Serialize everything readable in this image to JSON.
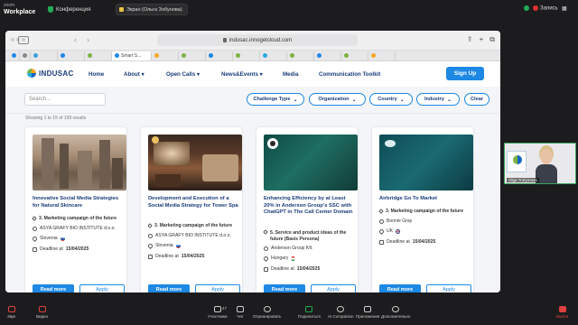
{
  "zoom": {
    "brand_top": "zoom",
    "brand": "Workplace",
    "meeting_label": "Конференция",
    "view_label": "Экран (Ольга Зобунова)",
    "recording_label": "Запись",
    "bottom": {
      "mic": "Звук",
      "video": "Видео",
      "participants": "Участники",
      "participants_count": "47",
      "chat": "Чат",
      "react": "Отреагировать",
      "share": "Поделиться",
      "ai": "AI Companion",
      "apps": "Приложения",
      "more": "Дополнительно",
      "end": "Выйти"
    }
  },
  "browser": {
    "url": "indusac.innogetcloud.com",
    "active_tab": "Smart S..."
  },
  "site": {
    "logo": "INDUSAC",
    "nav": [
      "Home",
      "About ▾",
      "Open Calls ▾",
      "News&Events ▾",
      "Media",
      "Communication Toolkit"
    ],
    "signup": "Sign Up",
    "search_placeholder": "Search...",
    "filters": [
      "Challenge Type",
      "Organization",
      "Country",
      "Industry"
    ],
    "clear": "Clear",
    "results": "Showing 1 to 15 of 199 results"
  },
  "cards": [
    {
      "title": "Innovative Social Media Strategies for Natural Skincare",
      "type": "3. Marketing campaign of the future",
      "org": "ASYA GRAFY BIO INSTITUTE d.o.o.",
      "country": "Slovenia",
      "deadline_label": "Deadline at",
      "deadline": "15/04/2025",
      "read": "Read more",
      "apply": "Apply"
    },
    {
      "title": "Development and Execution of a Social Media Strategy for Tower Spa",
      "type": "3. Marketing campaign of the future",
      "org": "ASYA GRAFY BIO INSTITUTE d.o.o.",
      "country": "Slovenia",
      "deadline_label": "Deadline at",
      "deadline": "15/04/2025",
      "read": "Read more",
      "apply": "Apply"
    },
    {
      "title": "Enhancing Efficiency by at Least 20% in Anderson Group's SSC with ChatGPT in The Call Center Domain",
      "type": "5. Service and product ideas of the future (Basis Persona)",
      "org": "Anderson Group Kft.",
      "country": "Hungary",
      "deadline_label": "Deadline at",
      "deadline": "15/04/2025",
      "read": "Read more",
      "apply": "Apply"
    },
    {
      "title": "Airbridge Go To Market",
      "type": "3. Marketing campaign of the future",
      "org": "Bonnie Gray",
      "country": "UK",
      "deadline_label": "Deadline at",
      "deadline": "15/04/2025",
      "read": "Read more",
      "apply": "Apply"
    }
  ],
  "participant": {
    "name": "Olga Trofymova"
  }
}
